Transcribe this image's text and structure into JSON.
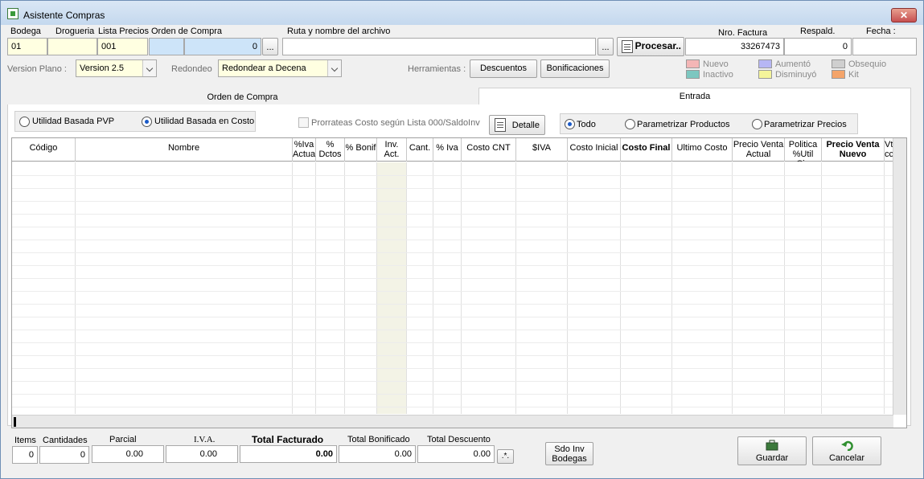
{
  "window": {
    "title": "Asistente Compras",
    "close_label": "✕"
  },
  "top": {
    "bodega_label": "Bodega",
    "bodega_value": "01",
    "drogueria_label": "Drogueria",
    "drogueria_value": "",
    "lista_label": "Lista Precios",
    "lista_value": "001",
    "orden_label": "Orden de Compra",
    "orden_value": "",
    "orden_num": "0",
    "browse_label": "...",
    "ruta_label": "Ruta y nombre del archivo",
    "ruta_value": "",
    "procesar_label": "Procesar..",
    "factura_label": "Nro. Factura",
    "factura_value": "33267473",
    "respald_label": "Respald.",
    "respald_value": "0",
    "fecha_label": "Fecha :",
    "fecha_value": ""
  },
  "options": {
    "version_label": "Version Plano :",
    "version_value": "Version 2.5",
    "redondeo_label": "Redondeo",
    "redondeo_value": "Redondear a Decena",
    "herramientas_label": "Herramientas :",
    "descuentos_label": "Descuentos",
    "bonificaciones_label": "Bonificaciones"
  },
  "legend": [
    {
      "label": "Nuevo",
      "color": "#f4b6b6"
    },
    {
      "label": "Inactivo",
      "color": "#7cc7c0"
    },
    {
      "label": "Aumentó",
      "color": "#b6b6f4"
    },
    {
      "label": "Disminuyó",
      "color": "#f4f49a"
    },
    {
      "label": "Obsequio",
      "color": "#cfcfcf"
    },
    {
      "label": "Kit",
      "color": "#f4a46a"
    }
  ],
  "tabs": {
    "orden": "Orden de Compra",
    "entrada": "Entrada"
  },
  "panel": {
    "utilidad_pvp": "Utilidad Basada PVP",
    "utilidad_costo": "Utilidad Basada en Costo",
    "prorrateas": "Prorrateas Costo según Lista 000/SaldoInv",
    "detalle": "Detalle",
    "todo": "Todo",
    "param_productos": "Parametrizar Productos",
    "param_precios": "Parametrizar Precios"
  },
  "grid_columns": [
    {
      "l1": "Código",
      "l2": ""
    },
    {
      "l1": "Nombre",
      "l2": ""
    },
    {
      "l1": "%Iva",
      "l2": "Actua"
    },
    {
      "l1": "%",
      "l2": "Dctos"
    },
    {
      "l1": "% Bonif",
      "l2": ""
    },
    {
      "l1": "Inv.",
      "l2": "Act."
    },
    {
      "l1": "Cant.",
      "l2": ""
    },
    {
      "l1": "% Iva",
      "l2": ""
    },
    {
      "l1": "Costo CNT",
      "l2": ""
    },
    {
      "l1": "$IVA",
      "l2": ""
    },
    {
      "l1": "Costo Inicial",
      "l2": ""
    },
    {
      "l1": "Costo Final",
      "l2": ""
    },
    {
      "l1": "Ultimo Costo",
      "l2": ""
    },
    {
      "l1": "Precio Venta",
      "l2": "Actual"
    },
    {
      "l1": "Politica",
      "l2": "%Util Cja"
    },
    {
      "l1": "Precio Venta",
      "l2": "Nuevo"
    },
    {
      "l1": "Vt",
      "l2": "cc"
    }
  ],
  "totals": {
    "items_label": "Items",
    "items_value": "0",
    "cantidades_label": "Cantidades",
    "cantidades_value": "0",
    "parcial_label": "Parcial",
    "parcial_value": "0.00",
    "iva_label": "I.V.A.",
    "iva_value": "0.00",
    "facturado_label": "Total Facturado",
    "facturado_value": "0.00",
    "bonificado_label": "Total Bonificado",
    "bonificado_value": "0.00",
    "descuento_label": "Total Descuento",
    "descuento_value": "0.00",
    "star_label": ".*.",
    "sdo_l1": "Sdo Inv",
    "sdo_l2": "Bodegas",
    "guardar_label": "Guardar",
    "cancelar_label": "Cancelar"
  }
}
